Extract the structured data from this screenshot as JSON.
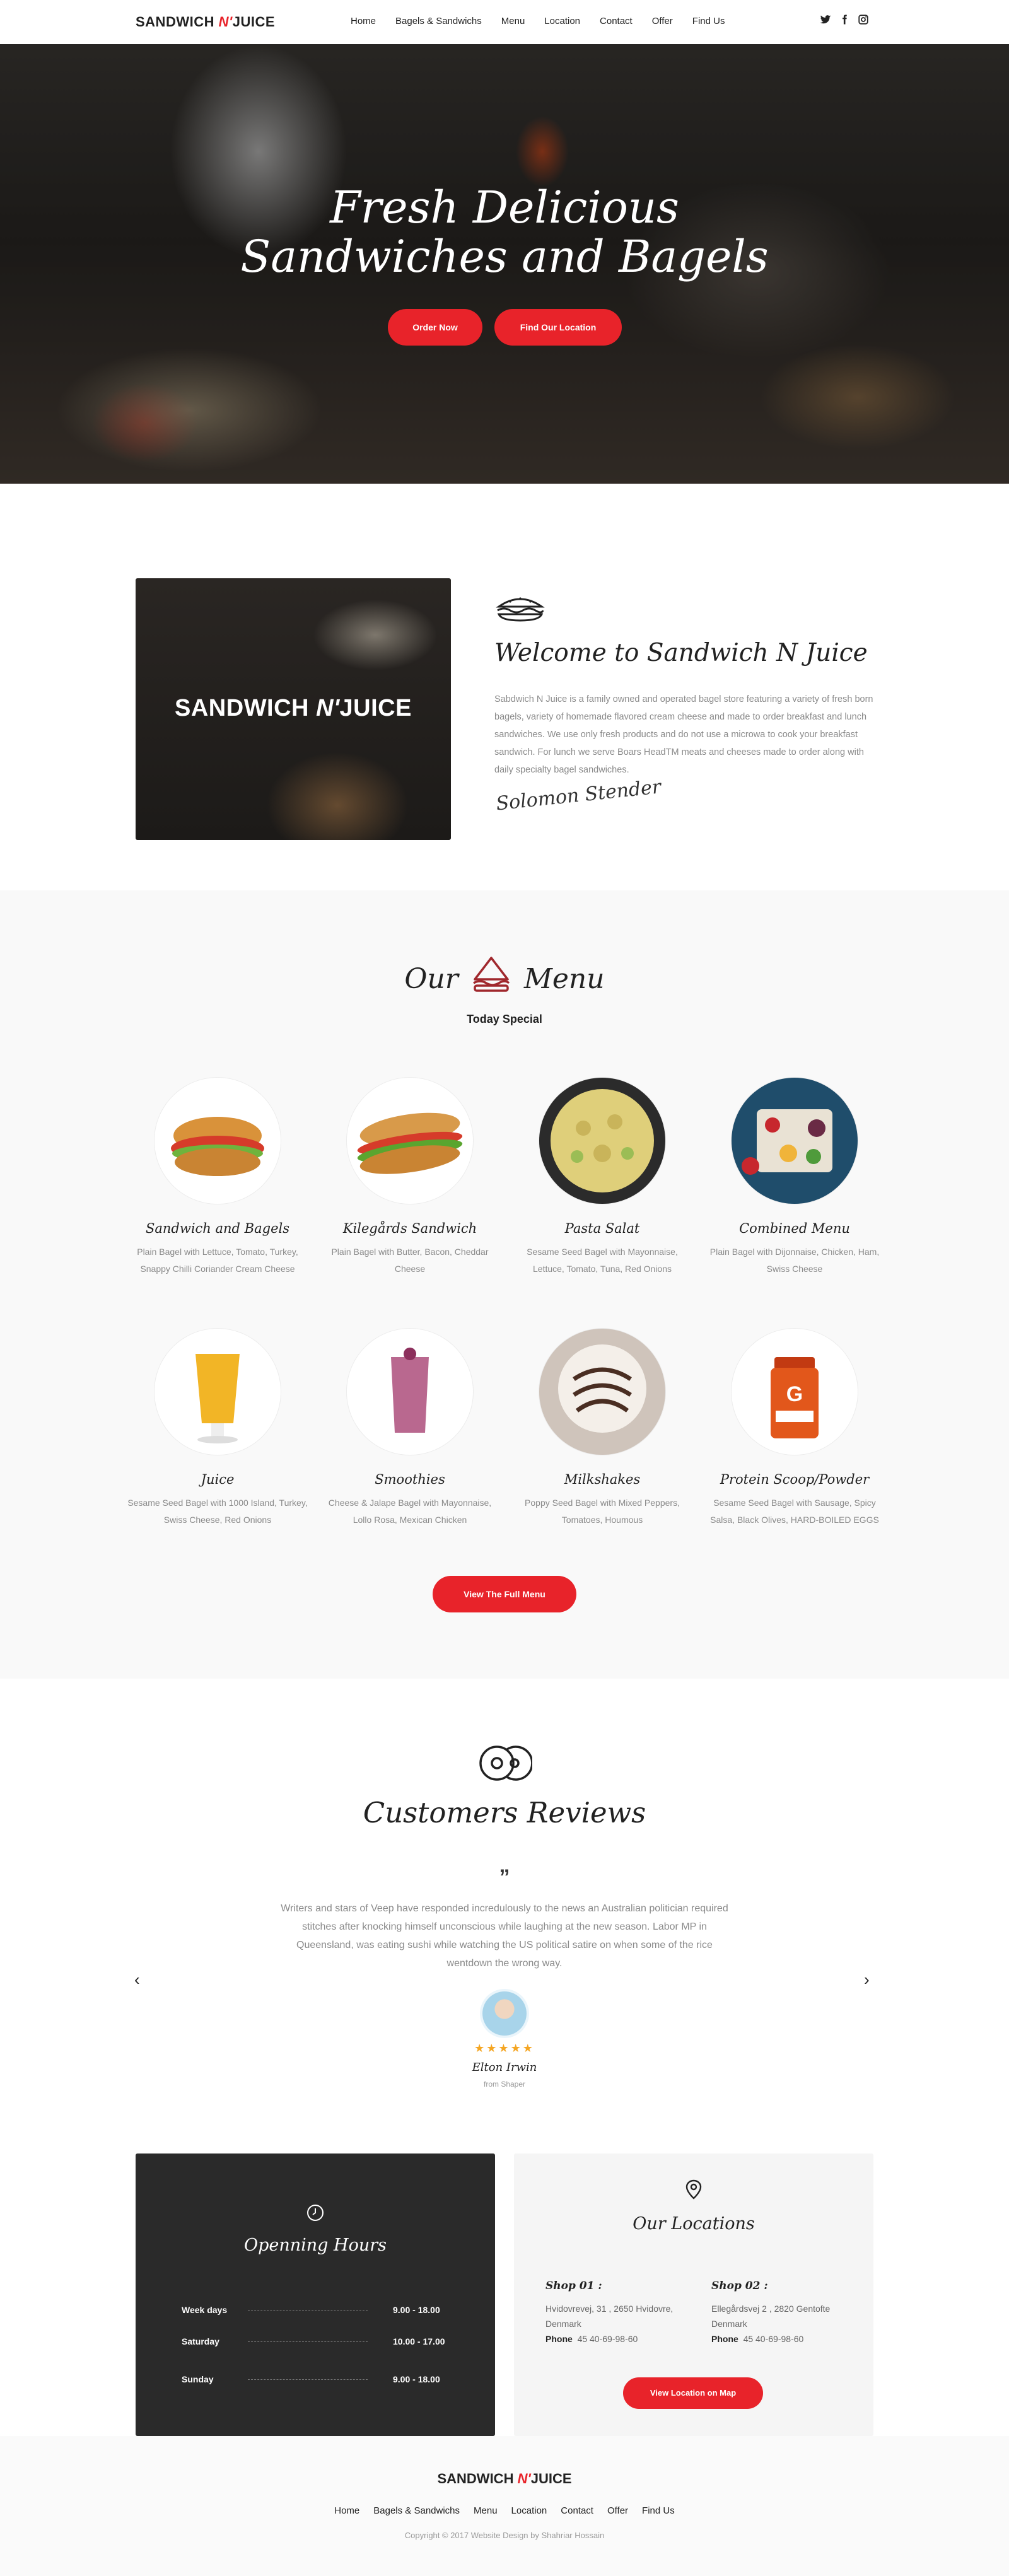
{
  "brand": {
    "left": "SANDWICH",
    "mid": "N'",
    "right": "JUICE",
    "accent": "#e8232a"
  },
  "nav": {
    "items": [
      "Home",
      "Bagels & Sandwichs",
      "Menu",
      "Location",
      "Contact",
      "Offer",
      "Find Us"
    ],
    "social": [
      "twitter-icon",
      "facebook-icon",
      "instagram-icon"
    ]
  },
  "hero": {
    "title_line1": "Fresh Delicious",
    "title_line2": "Sandwiches and Bagels",
    "order_btn": "Order Now",
    "location_btn": "Find Our Location"
  },
  "welcome": {
    "image_logo_left": "SANDWICH",
    "image_logo_mid": "N'",
    "image_logo_right": "JUICE",
    "title": "Welcome to Sandwich N Juice",
    "text": "Sabdwich N Juice  is a family owned and operated bagel store featuring a variety  of fresh  born bagels, variety of homemade flavored cream cheese and made to order breakfast and lunch sandwiches.  We use only fresh products and do not use a microwa  to cook your breakfast sandwich.  For lunch we serve Boars HeadTM meats and cheeses made to order along with  daily specialty bagel sandwiches.",
    "signature": "Solomon Stender"
  },
  "menu": {
    "title_left": "Our",
    "title_right": "Menu",
    "subtitle": "Today Special",
    "items": [
      {
        "name": "Sandwich and Bagels",
        "desc": "Plain Bagel with Lettuce, Tomato, Turkey, Snappy Chilli Coriander Cream Cheese"
      },
      {
        "name": "Kilegårds Sandwich",
        "desc": "Plain Bagel with Butter, Bacon, Cheddar Cheese"
      },
      {
        "name": "Pasta Salat",
        "desc": "Sesame Seed Bagel with Mayonnaise, Lettuce, Tomato, Tuna, Red Onions"
      },
      {
        "name": "Combined Menu",
        "desc": "Plain Bagel with Dijonnaise, Chicken, Ham, Swiss Cheese"
      },
      {
        "name": "Juice",
        "desc": "Sesame Seed Bagel with 1000 Island, Turkey, Swiss Cheese, Red Onions"
      },
      {
        "name": "Smoothies",
        "desc": "Cheese & Jalape Bagel with Mayonnaise, Lollo Rosa, Mexican Chicken"
      },
      {
        "name": "Milkshakes",
        "desc": "Poppy Seed Bagel with Mixed Peppers, Tomatoes, Houmous"
      },
      {
        "name": "Protein Scoop/Powder",
        "desc": "Sesame Seed Bagel with Sausage, Spicy Salsa, Black Olives, HARD-BOILED EGGS"
      }
    ],
    "full_menu_btn": "View The Full Menu"
  },
  "reviews": {
    "title": "Customers Reviews",
    "quote": "Writers and stars of Veep have responded incredulously to the news an Australian politician required stitches after knocking himself unconscious while laughing at the new season. Labor MP in Queensland, was eating sushi while  watching the US political satire on when some of the rice wentdown the wrong way.",
    "stars": "★★★★★",
    "rating": 5,
    "name": "Elton Irwin",
    "from": "from Shaper"
  },
  "hours": {
    "title": "Openning Hours",
    "rows": [
      {
        "day": "Week days",
        "time": "9.00 - 18.00"
      },
      {
        "day": "Saturday",
        "time": "10.00 - 17.00"
      },
      {
        "day": "Sunday",
        "time": "9.00 - 18.00"
      }
    ]
  },
  "locations": {
    "title": "Our Locations",
    "shops": [
      {
        "title": "Shop 01 :",
        "address": "Hvidovrevej, 31 , 2650 Hvidovre, Denmark",
        "phone_label": "Phone",
        "phone": "45 40-69-98-60"
      },
      {
        "title": "Shop 02 :",
        "address": "Ellegårdsvej 2 , 2820 Gentofte Denmark",
        "phone_label": "Phone",
        "phone": "45 40-69-98-60"
      }
    ],
    "map_btn": "View Location on Map"
  },
  "footer": {
    "logo_left": "SANDWICH",
    "logo_mid": "N'",
    "logo_right": "JUICE",
    "items": [
      "Home",
      "Bagels & Sandwichs",
      "Menu",
      "Location",
      "Contact",
      "Offer",
      "Find Us"
    ],
    "copyright": "Copyright © 2017 Website Design by Shahriar Hossain"
  }
}
